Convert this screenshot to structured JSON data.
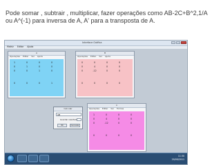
{
  "slide": {
    "caption": "Pode somar , subtrair , multiplicar, fazer operações como AB-2C+B^2,1/A ou A^(-1) para inversa de A, A' para a transposta de A."
  },
  "app": {
    "title": "Interface Gráfica",
    "menu": [
      "Matriz",
      "Editar",
      "Ajuda"
    ]
  },
  "matrices": [
    {
      "id": "A",
      "title": "A",
      "color": "#7fd3f5",
      "menu": [
        "Operações",
        "Editar",
        "Ver",
        "Ajuda"
      ],
      "rows": [
        [
          "1",
          "0",
          "0",
          "0"
        ],
        [
          "0",
          "1",
          "0",
          "0"
        ],
        [
          "0",
          "0",
          "1",
          "0"
        ],
        [
          "0",
          "0",
          "0",
          "1"
        ]
      ]
    },
    {
      "id": "B",
      "title": "B",
      "color": "#f7c2c6",
      "menu": [
        "Operações",
        "Editar",
        "Ver",
        "Ajuda"
      ],
      "rows": [
        [
          "0",
          "0",
          "0",
          "0"
        ],
        [
          "0",
          "4",
          "0",
          "0"
        ],
        [
          "0",
          "-12",
          "0",
          "0"
        ],
        [
          "0",
          "0",
          "0",
          "0"
        ]
      ]
    },
    {
      "id": "C",
      "title": "C",
      "color": "#f58be6",
      "menu": [
        "Operações",
        "Editar",
        "Ver",
        "Formas"
      ],
      "rows": [
        [
          "1",
          "0",
          "0",
          "0"
        ],
        [
          "0",
          "4",
          "0",
          "0"
        ],
        [
          "0",
          "-12",
          "0",
          "0"
        ],
        [
          "0",
          "0",
          "0",
          "0"
        ]
      ]
    }
  ],
  "dialog": {
    "title": "Calcular",
    "expression": "AB",
    "label": "Guardar resultado",
    "ok": "Ok",
    "cancel": "Cancelar"
  },
  "taskbar": {
    "time": "11:30",
    "date": "29/09/2011"
  }
}
